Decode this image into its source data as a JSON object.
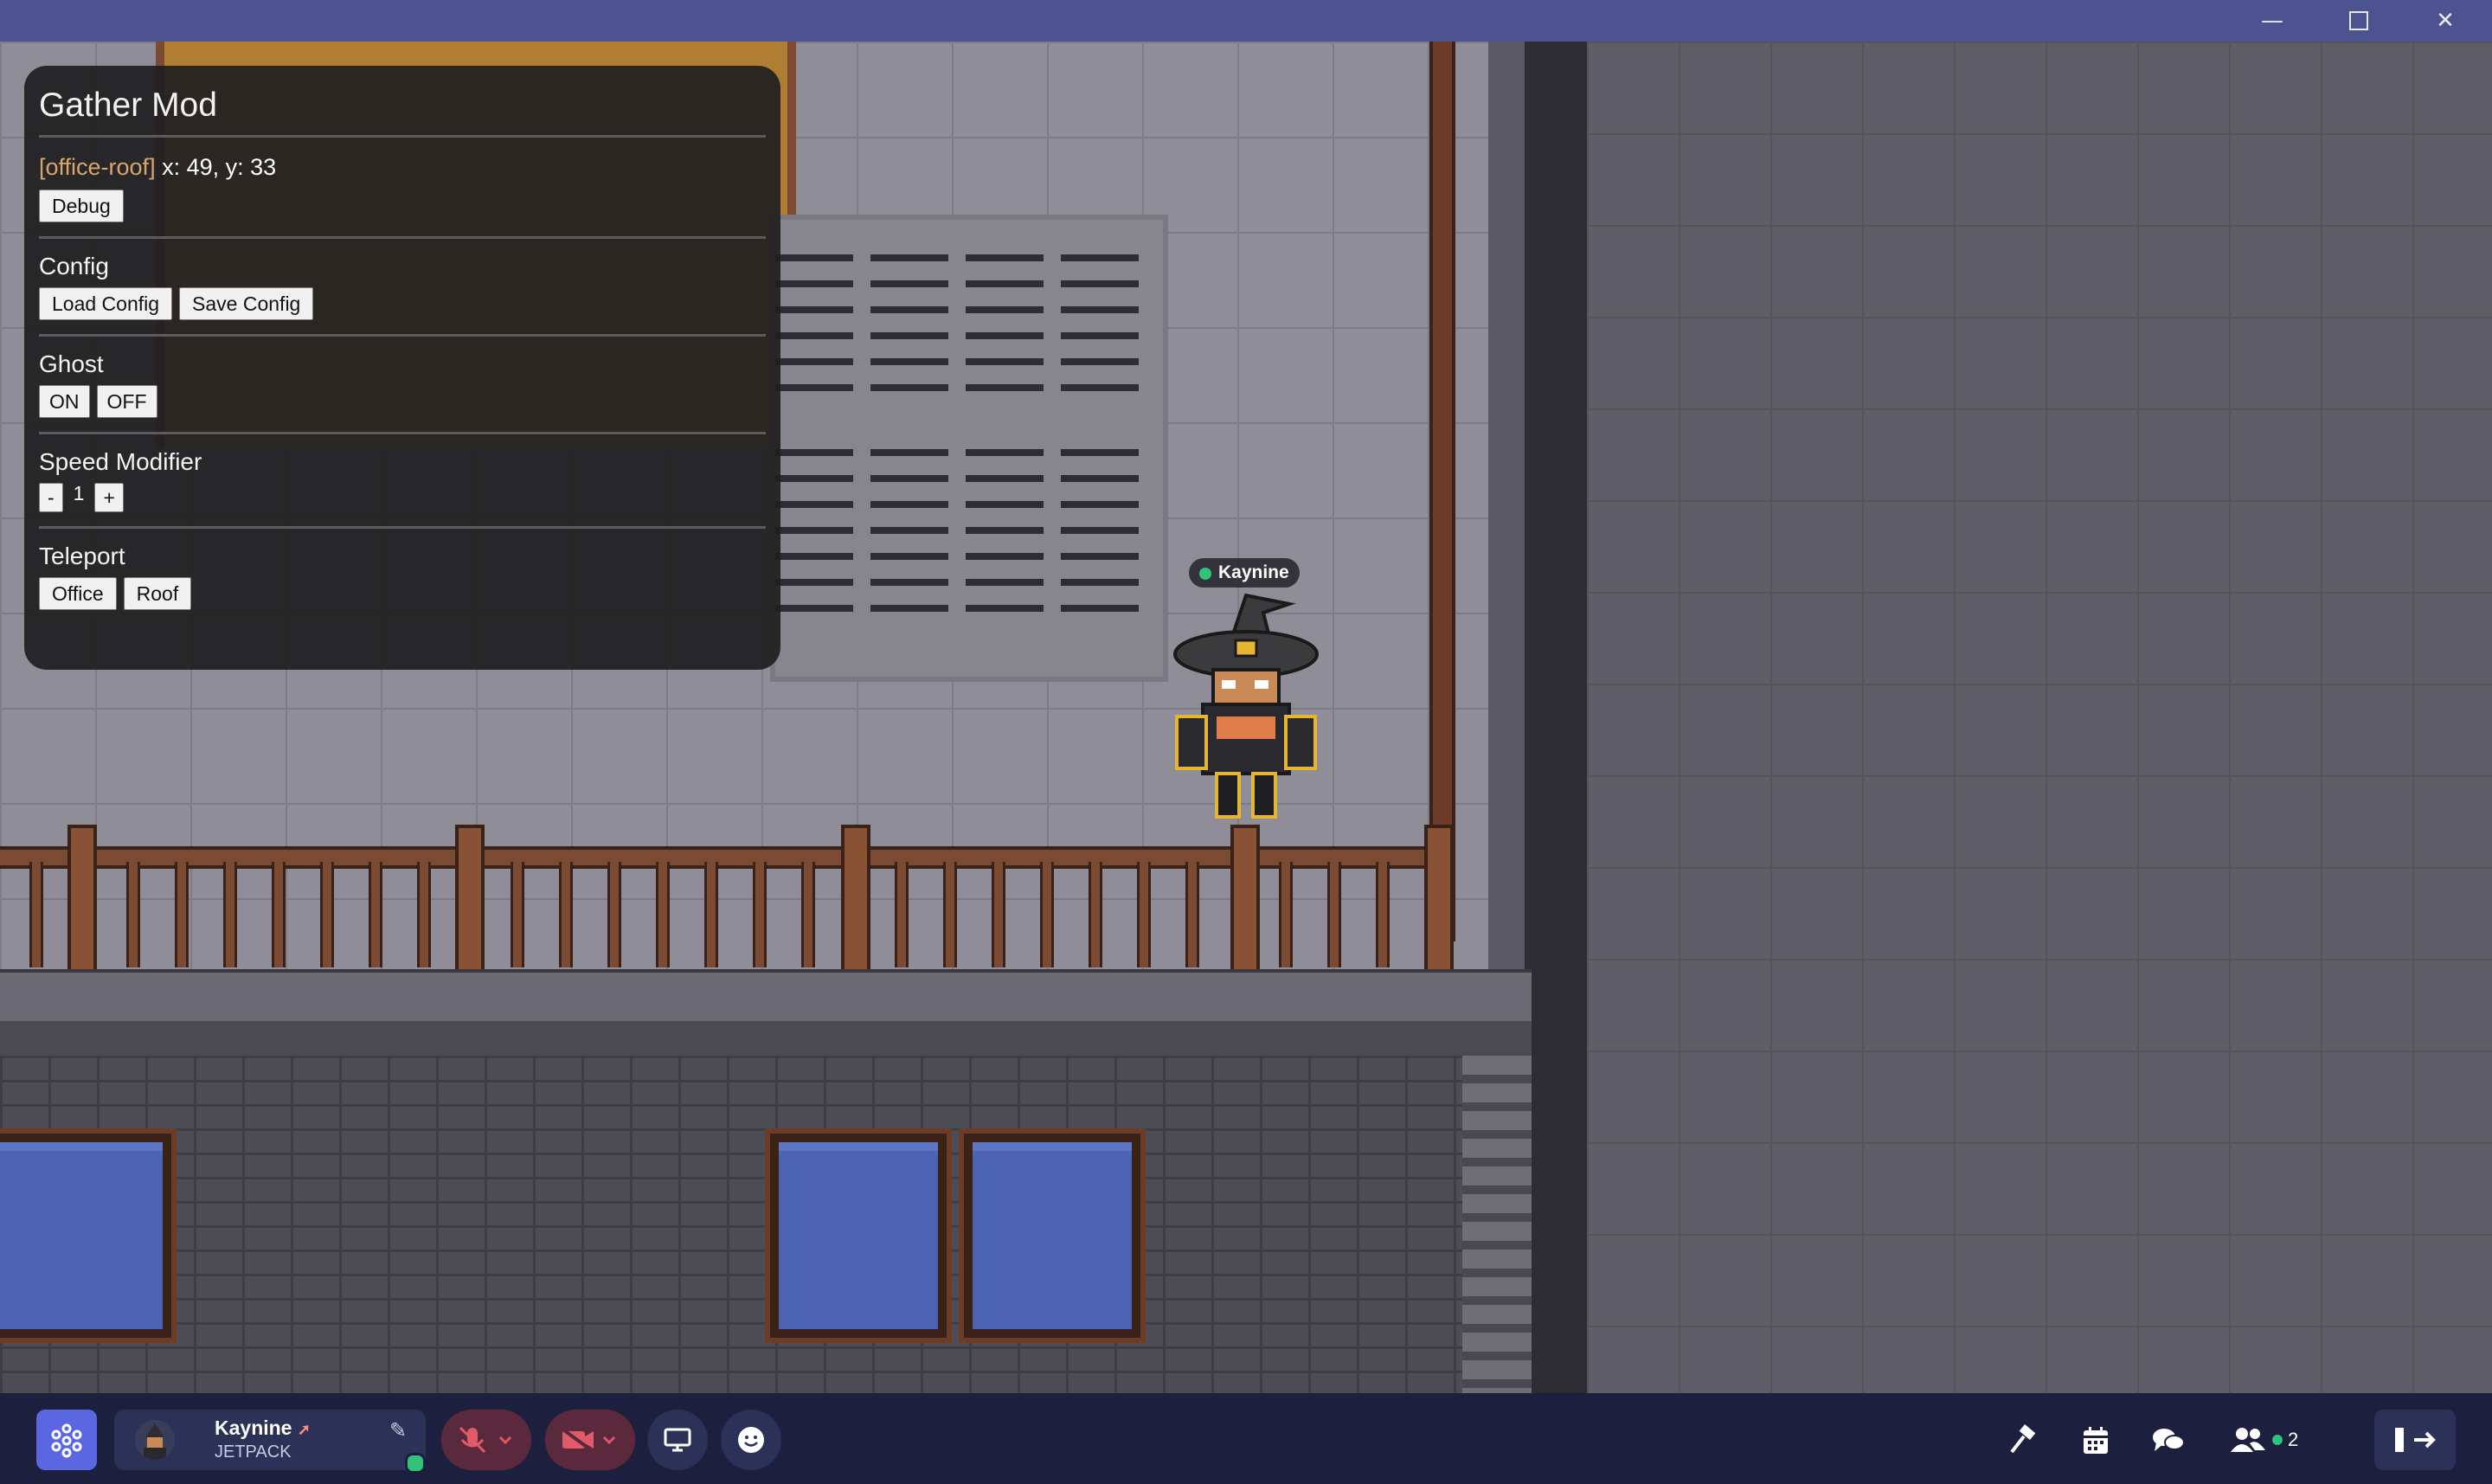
{
  "window": {
    "minimize_icon": "minimize-icon",
    "maximize_icon": "maximize-icon",
    "close_icon": "close-icon"
  },
  "mod_panel": {
    "title": "Gather Mod",
    "location_room": "[office-roof]",
    "location_coords": "x: 49, y: 33",
    "debug_label": "Debug",
    "config": {
      "title": "Config",
      "load_label": "Load Config",
      "save_label": "Save Config"
    },
    "ghost": {
      "title": "Ghost",
      "on_label": "ON",
      "off_label": "OFF"
    },
    "speed": {
      "title": "Speed Modifier",
      "minus_label": "-",
      "value": "1",
      "plus_label": "+"
    },
    "teleport": {
      "title": "Teleport",
      "office_label": "Office",
      "roof_label": "Roof"
    }
  },
  "world": {
    "player_name": "Kaynine"
  },
  "bottom_bar": {
    "user_name": "Kaynine",
    "user_status": "JETPACK",
    "participants_count": "2",
    "colors": {
      "bar": "#1c1f3d",
      "logo": "#5a67e0",
      "muted": "#e05a6a",
      "online": "#33c27a"
    }
  }
}
